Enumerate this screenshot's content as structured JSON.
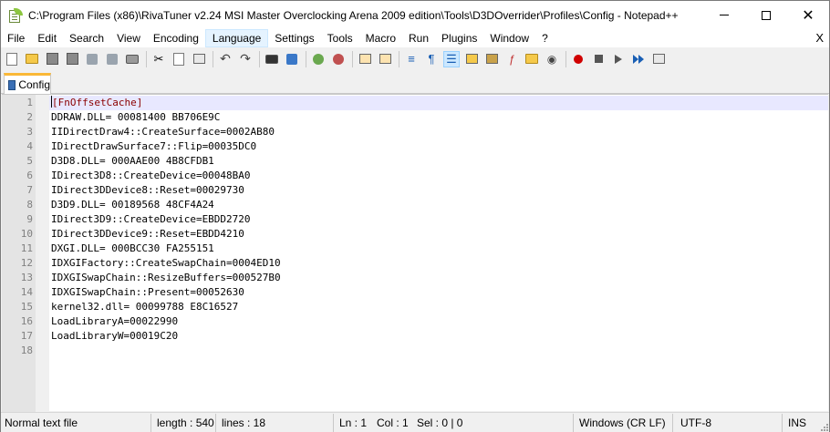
{
  "window": {
    "title": "C:\\Program Files (x86)\\RivaTuner v2.24 MSI Master Overclocking Arena 2009 edition\\Tools\\D3DOverrider\\Profiles\\Config - Notepad++",
    "minimize_glyph": "—",
    "maximize_glyph": "☐",
    "close_glyph": "✕"
  },
  "menu": {
    "items": [
      "File",
      "Edit",
      "Search",
      "View",
      "Encoding",
      "Language",
      "Settings",
      "Tools",
      "Macro",
      "Run",
      "Plugins",
      "Window",
      "?"
    ],
    "hovered": "Language",
    "close_glyph": "X"
  },
  "toolbar": {
    "buttons": [
      "new-file-icon",
      "open-file-icon",
      "save-icon",
      "save-all-icon",
      "close-icon",
      "close-all-icon",
      "print-icon",
      "cut-icon",
      "copy-icon",
      "paste-icon",
      "undo-icon",
      "redo-icon",
      "find-icon",
      "replace-icon",
      "zoom-in-icon",
      "zoom-out-icon",
      "sync-vertical-icon",
      "sync-horizontal-icon",
      "word-wrap-icon",
      "show-all-characters-icon",
      "indent-guide-icon",
      "user-defined-language-icon",
      "document-map-icon",
      "function-list-icon",
      "folder-as-workspace-icon",
      "monitoring-icon",
      "record-macro-icon",
      "stop-recording-icon",
      "playback-macro-icon",
      "run-macro-multiple-icon",
      "save-macro-icon"
    ]
  },
  "tabs": [
    {
      "label": "Config",
      "icon": "saved-file-icon",
      "active": true
    }
  ],
  "editor": {
    "current_line": 1,
    "lines": [
      {
        "n": "1",
        "text": "[FnOffsetCache]",
        "kind": "section"
      },
      {
        "n": "2",
        "text": "DDRAW.DLL= 00081400 BB706E9C",
        "kind": "plain"
      },
      {
        "n": "3",
        "text": "IIDirectDraw4::CreateSurface=0002AB80",
        "kind": "plain"
      },
      {
        "n": "4",
        "text": "IDirectDrawSurface7::Flip=00035DC0",
        "kind": "plain"
      },
      {
        "n": "5",
        "text": "D3D8.DLL= 000AAE00 4B8CFDB1",
        "kind": "plain"
      },
      {
        "n": "6",
        "text": "IDirect3D8::CreateDevice=00048BA0",
        "kind": "plain"
      },
      {
        "n": "7",
        "text": "IDirect3DDevice8::Reset=00029730",
        "kind": "plain"
      },
      {
        "n": "8",
        "text": "D3D9.DLL= 00189568 48CF4A24",
        "kind": "plain"
      },
      {
        "n": "9",
        "text": "IDirect3D9::CreateDevice=EBDD2720",
        "kind": "plain"
      },
      {
        "n": "10",
        "text": "IDirect3DDevice9::Reset=EBDD4210",
        "kind": "plain"
      },
      {
        "n": "11",
        "text": "DXGI.DLL= 000BCC30 FA255151",
        "kind": "plain"
      },
      {
        "n": "12",
        "text": "IDXGIFactory::CreateSwapChain=0004ED10",
        "kind": "plain"
      },
      {
        "n": "13",
        "text": "IDXGISwapChain::ResizeBuffers=000527B0",
        "kind": "plain"
      },
      {
        "n": "14",
        "text": "IDXGISwapChain::Present=00052630",
        "kind": "plain"
      },
      {
        "n": "15",
        "text": "kernel32.dll= 00099788 E8C16527",
        "kind": "plain"
      },
      {
        "n": "16",
        "text": "LoadLibraryA=00022990",
        "kind": "plain"
      },
      {
        "n": "17",
        "text": "LoadLibraryW=00019C20",
        "kind": "plain"
      },
      {
        "n": "18",
        "text": "",
        "kind": "plain"
      }
    ]
  },
  "status": {
    "file_type": "Normal text file",
    "length": "length : 540",
    "lines": "lines : 18",
    "ln": "Ln : 1",
    "col": "Col : 1",
    "sel": "Sel : 0 | 0",
    "eol": "Windows (CR LF)",
    "encoding": "UTF-8",
    "insert_mode": "INS"
  },
  "colors": {
    "section_text": "#8b0000",
    "current_line_bg": "#e8e8ff",
    "tab_accent": "#fab837",
    "gutter_bg": "#e4e4e4"
  }
}
